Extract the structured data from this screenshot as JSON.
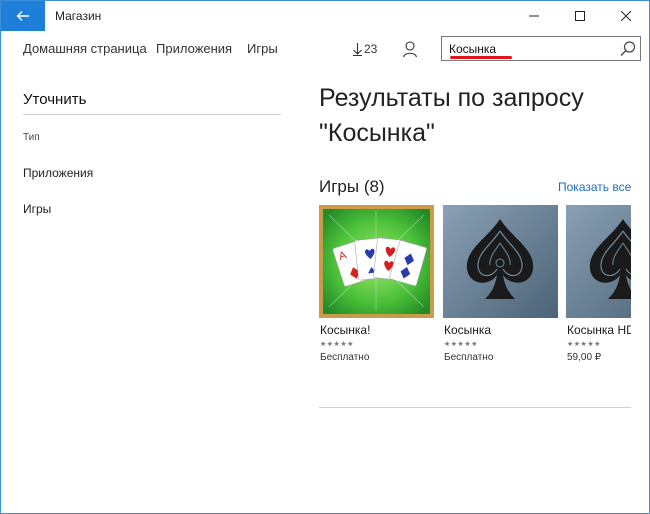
{
  "window": {
    "title": "Магазин",
    "accent": "#1e7fd8"
  },
  "nav": {
    "home": "Домашняя страница",
    "apps": "Приложения",
    "games": "Игры",
    "downloads_count": "23"
  },
  "search": {
    "value": "Косынка"
  },
  "sidebar": {
    "title": "Уточнить",
    "type_label": "Тип",
    "filters": [
      "Приложения",
      "Игры"
    ]
  },
  "results": {
    "title": "Результаты по запросу \"Косынка\"",
    "section_title": "Игры (8)",
    "show_all": "Показать все",
    "items": [
      {
        "name": "Косынка!",
        "stars": "★★★★★",
        "price": "Бесплатно",
        "icon": "solitaire-cards-icon"
      },
      {
        "name": "Косынка",
        "stars": "★★★★★",
        "price": "Бесплатно",
        "icon": "spade-icon"
      },
      {
        "name": "Косынка HD",
        "stars": "★★★★★",
        "price": "59,00 ₽",
        "icon": "spade-icon"
      }
    ]
  }
}
